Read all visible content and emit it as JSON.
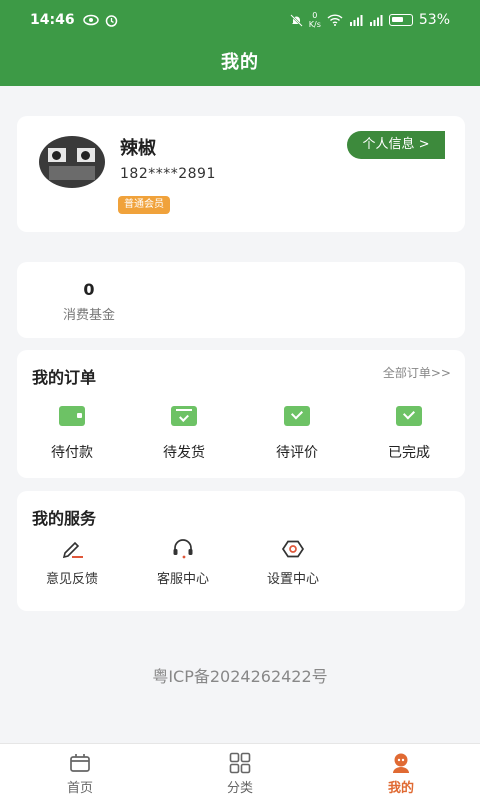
{
  "status_bar": {
    "time": "14:46",
    "net_speed_value": "0",
    "net_speed_unit": "K/s",
    "battery_pct": "53%"
  },
  "header": {
    "title": "我的"
  },
  "profile": {
    "name": "辣椒",
    "phone": "182****2891",
    "member_badge": "普通会员",
    "info_button": "个人信息 >"
  },
  "fund": {
    "value": "0",
    "label": "消费基金"
  },
  "orders": {
    "title": "我的订单",
    "all_link": "全部订单>>",
    "items": [
      {
        "label": "待付款",
        "icon": "wallet-icon"
      },
      {
        "label": "待发货",
        "icon": "package-icon"
      },
      {
        "label": "待评价",
        "icon": "review-icon"
      },
      {
        "label": "已完成",
        "icon": "completed-icon"
      }
    ]
  },
  "services": {
    "title": "我的服务",
    "items": [
      {
        "label": "意见反馈",
        "icon": "pen-icon"
      },
      {
        "label": "客服中心",
        "icon": "headset-icon"
      },
      {
        "label": "设置中心",
        "icon": "hex-nut-icon"
      }
    ]
  },
  "icp": "粤ICP备2024262422号",
  "tabbar": {
    "items": [
      {
        "label": "首页",
        "icon": "home-icon"
      },
      {
        "label": "分类",
        "icon": "grid-icon"
      },
      {
        "label": "我的",
        "icon": "user-icon",
        "active": true
      }
    ]
  },
  "colors": {
    "brand_green": "#3d9a46",
    "button_green": "#3d8a3c",
    "icon_green": "#6dc265",
    "badge_orange": "#f0a23b",
    "active_tab": "#e06a33"
  }
}
